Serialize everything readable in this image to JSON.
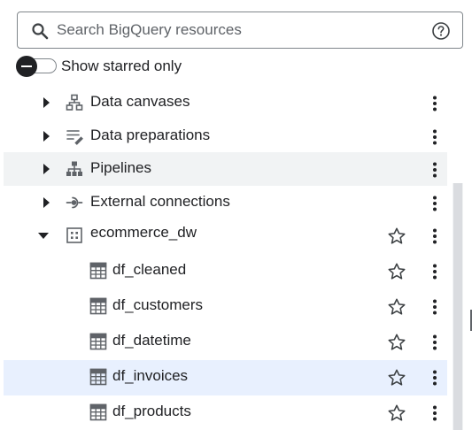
{
  "search": {
    "placeholder": "Search BigQuery resources",
    "search_icon": "search-icon",
    "help_icon": "help-circle-icon"
  },
  "starred_toggle": {
    "label": "Show starred only",
    "checked": false
  },
  "tree": {
    "items": [
      {
        "label": "Data canvases",
        "icon": "data-canvas-icon",
        "expander": "collapsed",
        "starrable": false
      },
      {
        "label": "Data preparations",
        "icon": "data-preparation-icon",
        "expander": "collapsed",
        "starrable": false
      },
      {
        "label": "Pipelines",
        "icon": "pipelines-icon",
        "expander": "collapsed",
        "starrable": false,
        "state": "hover"
      },
      {
        "label": "External connections",
        "icon": "external-connection-icon",
        "expander": "collapsed",
        "starrable": false
      },
      {
        "label": "ecommerce_dw",
        "icon": "dataset-icon",
        "expander": "expanded",
        "starrable": true
      },
      {
        "label": "df_cleaned",
        "icon": "table-icon",
        "starrable": true
      },
      {
        "label": "df_customers",
        "icon": "table-icon",
        "starrable": true
      },
      {
        "label": "df_datetime",
        "icon": "table-icon",
        "starrable": true
      },
      {
        "label": "df_invoices",
        "icon": "table-icon",
        "starrable": true,
        "state": "selected"
      },
      {
        "label": "df_products",
        "icon": "table-icon",
        "starrable": true
      }
    ]
  },
  "colors": {
    "text": "#202124",
    "icon": "#5f6368",
    "hover_row": "#f1f3f4",
    "selected_row": "#e8f0fe",
    "border": "#80868b"
  }
}
